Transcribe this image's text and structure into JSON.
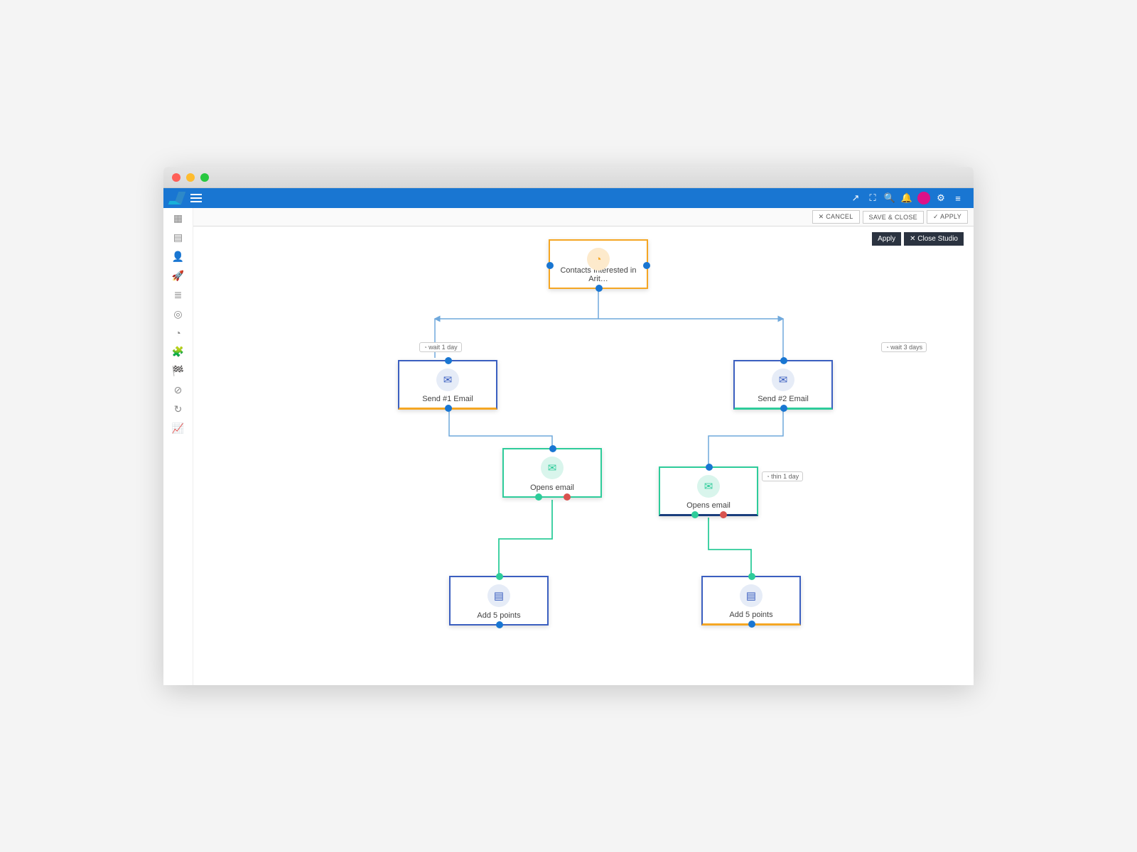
{
  "toolbar": {
    "cancel": "✕ CANCEL",
    "saveclose": "SAVE & CLOSE",
    "apply": "✓ APPLY"
  },
  "studio": {
    "apply": "Apply",
    "close": "✕  Close Studio"
  },
  "nodes": {
    "root": "Contacts Interested in Arit…",
    "send1": "Send #1 Email",
    "send2": "Send #2 Email",
    "opens1": "Opens email",
    "opens2": "Opens email",
    "points1": "Add 5 points",
    "points2": "Add 5 points"
  },
  "waits": {
    "w1": "wait 1 day",
    "w3": "wait 3 days",
    "within1": "thin 1 day"
  }
}
